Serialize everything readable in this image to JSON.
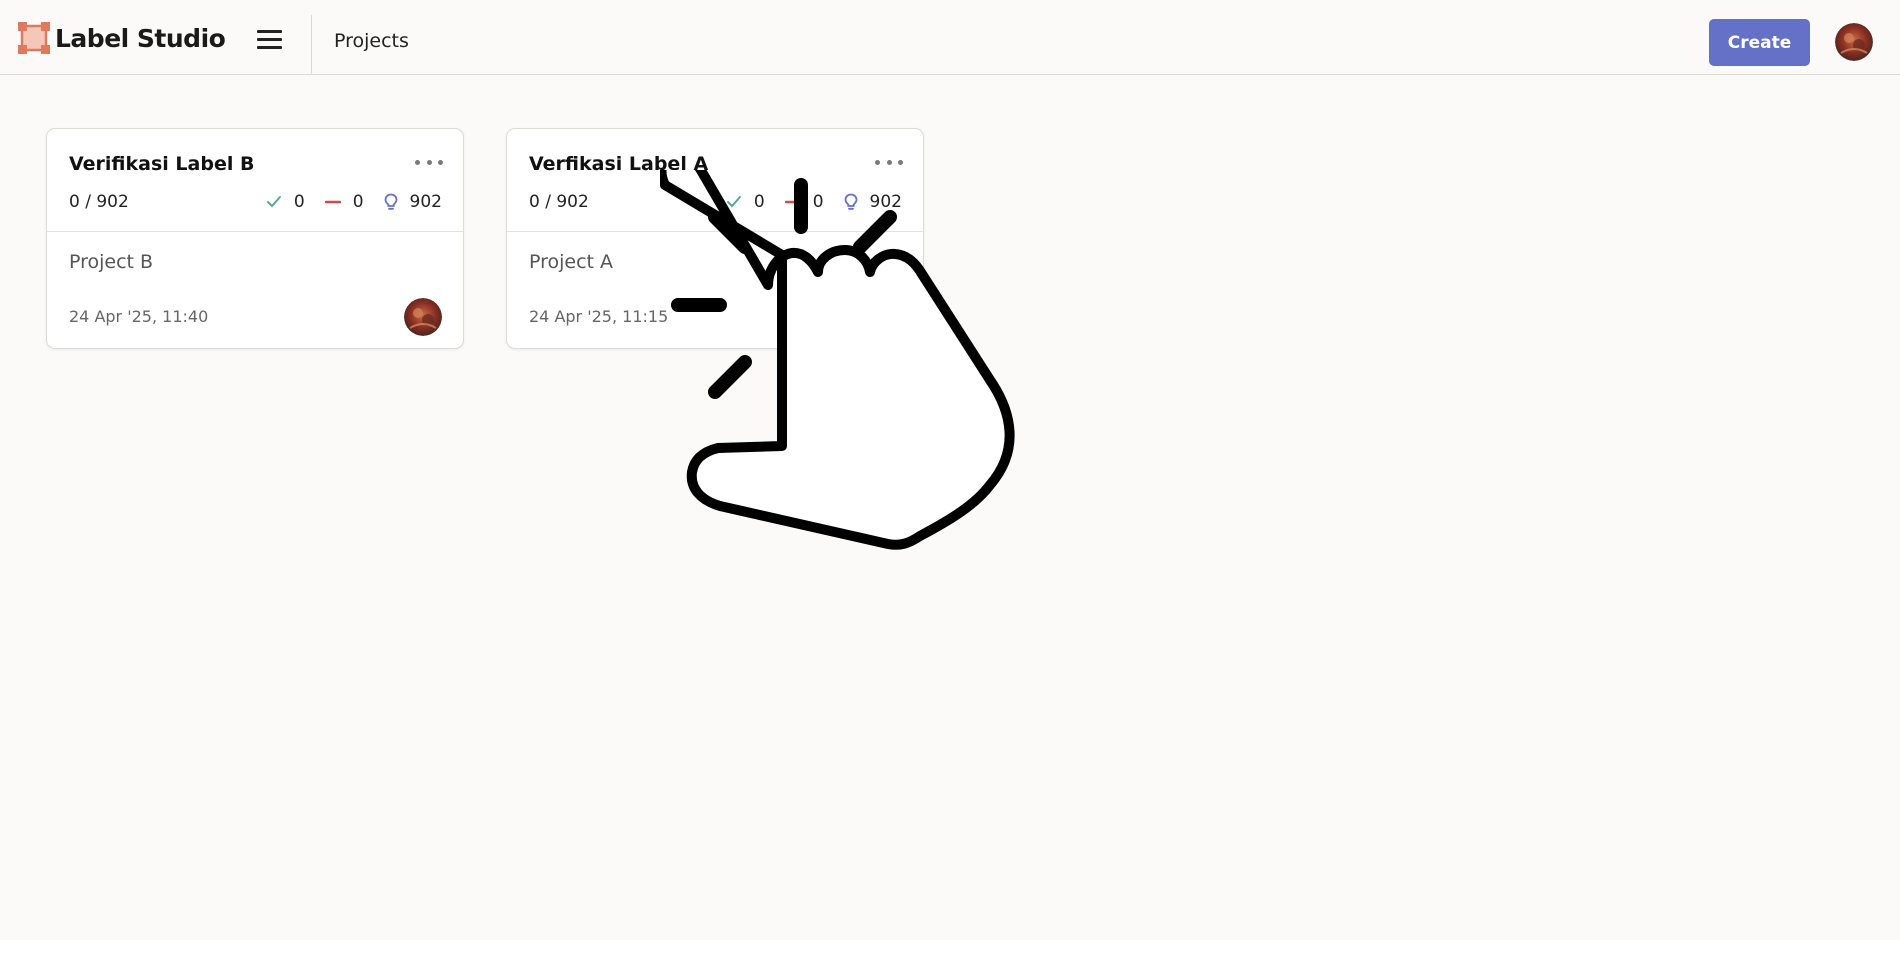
{
  "app": {
    "brand_name": "Label Studio",
    "accent_color": "#6471c6",
    "logo_color": "#e07a5f"
  },
  "header": {
    "breadcrumb": "Projects",
    "create_label": "Create",
    "menu_icon": "hamburger-menu-icon",
    "avatar_icon": "user-avatar"
  },
  "projects": [
    {
      "title": "Verifikasi Label B",
      "progress": "0 / 902",
      "completed": "0",
      "skipped": "0",
      "predictions": "902",
      "description": "Project B",
      "date": "24 Apr '25, 11:40"
    },
    {
      "title": "Verfikasi Label A",
      "progress": "0 / 902",
      "completed": "0",
      "skipped": "0",
      "predictions": "902",
      "description": "Project A",
      "date": "24 Apr '25, 11:15"
    }
  ],
  "icons": {
    "completed": "check-icon",
    "skipped": "minus-icon",
    "predictions": "lightbulb-icon",
    "more": "ellipsis-icon",
    "pointer": "hand-click-icon"
  },
  "colors": {
    "check": "#5aa98a",
    "minus": "#d14b4b",
    "bulb": "#6471c6"
  }
}
